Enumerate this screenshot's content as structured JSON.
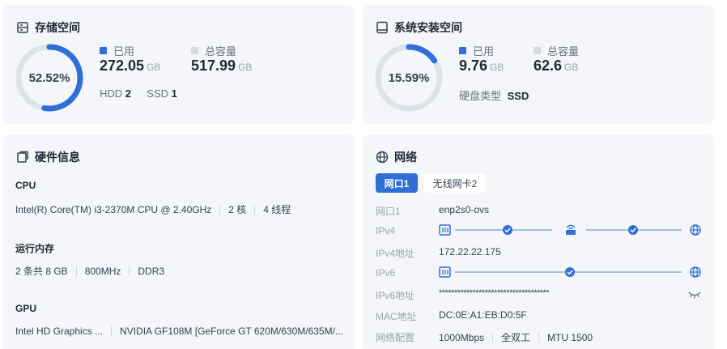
{
  "colors": {
    "accent": "#2f6fd6",
    "track": "#dde3ea",
    "free": "#d7dbe0"
  },
  "storage": {
    "title": "存储空间",
    "percent": 52.52,
    "percent_label": "52.52%",
    "used_label": "已用",
    "used_value": "272.05",
    "used_unit": "GB",
    "total_label": "总容量",
    "total_value": "517.99",
    "total_unit": "GB",
    "hdd_label": "HDD",
    "hdd_count": "2",
    "ssd_label": "SSD",
    "ssd_count": "1"
  },
  "system": {
    "title": "系统安装空间",
    "percent": 15.59,
    "percent_label": "15.59%",
    "used_label": "已用",
    "used_value": "9.76",
    "used_unit": "GB",
    "total_label": "总容量",
    "total_value": "62.6",
    "total_unit": "GB",
    "disk_type_label": "硬盘类型",
    "disk_type_value": "SSD"
  },
  "hardware": {
    "title": "硬件信息",
    "cpu_label": "CPU",
    "cpu_model": "Intel(R) Core(TM) i3-2370M CPU @ 2.40GHz",
    "cpu_cores": "2 核",
    "cpu_threads": "4 线程",
    "mem_label": "运行内存",
    "mem_sticks": "2 条共 8 GB",
    "mem_speed": "800MHz",
    "mem_type": "DDR3",
    "gpu_label": "GPU",
    "gpu_1": "Intel HD Graphics ...",
    "gpu_2": "NVIDIA GF108M [GeForce GT 620M/630M/635M/..."
  },
  "network": {
    "title": "网络",
    "tabs": [
      {
        "label": "网口1",
        "active": true
      },
      {
        "label": "无线网卡2",
        "active": false
      }
    ],
    "port_label": "网口1",
    "port_value": "enp2s0-ovs",
    "ipv4_label": "IPv4",
    "ipv4_addr_label": "IPv4地址",
    "ipv4_addr": "172.22.22.175",
    "ipv6_label": "IPv6",
    "ipv6_addr_label": "IPv6地址",
    "ipv6_addr": "************************************",
    "mac_label": "MAC地址",
    "mac_value": "DC:0E:A1:EB:D0:5F",
    "config_label": "网络配置",
    "config_speed": "1000Mbps",
    "config_duplex": "全双工",
    "config_mtu": "MTU 1500"
  }
}
